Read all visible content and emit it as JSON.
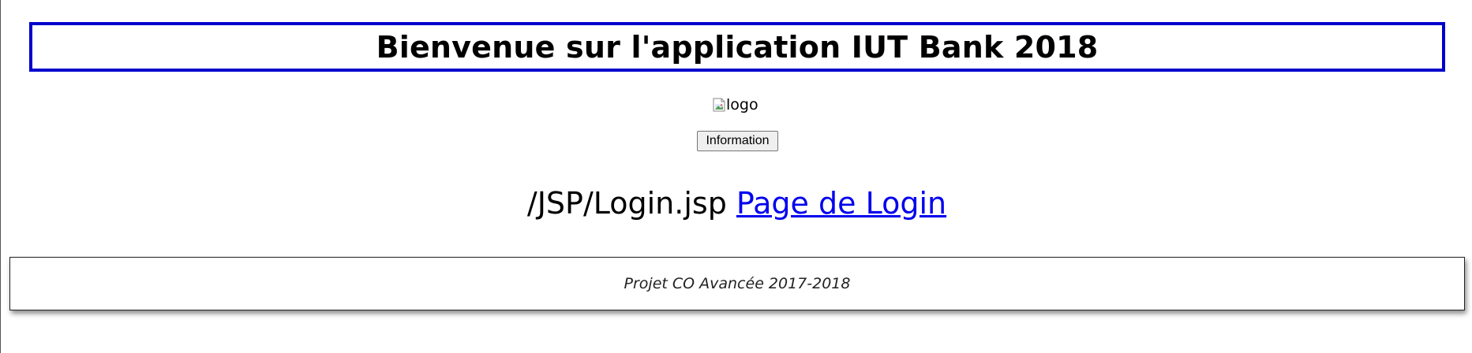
{
  "header": {
    "title": "Bienvenue sur l'application IUT Bank 2018",
    "border_color": "#0000cc"
  },
  "logo": {
    "alt_text": "logo",
    "icon": "broken-image-icon"
  },
  "info_button": {
    "label": "Information"
  },
  "login": {
    "path_text": "/JSP/Login.jsp",
    "link_text": "Page de Login",
    "link_color": "#0000ee"
  },
  "footer": {
    "text": "Projet CO Avancée 2017-2018"
  }
}
